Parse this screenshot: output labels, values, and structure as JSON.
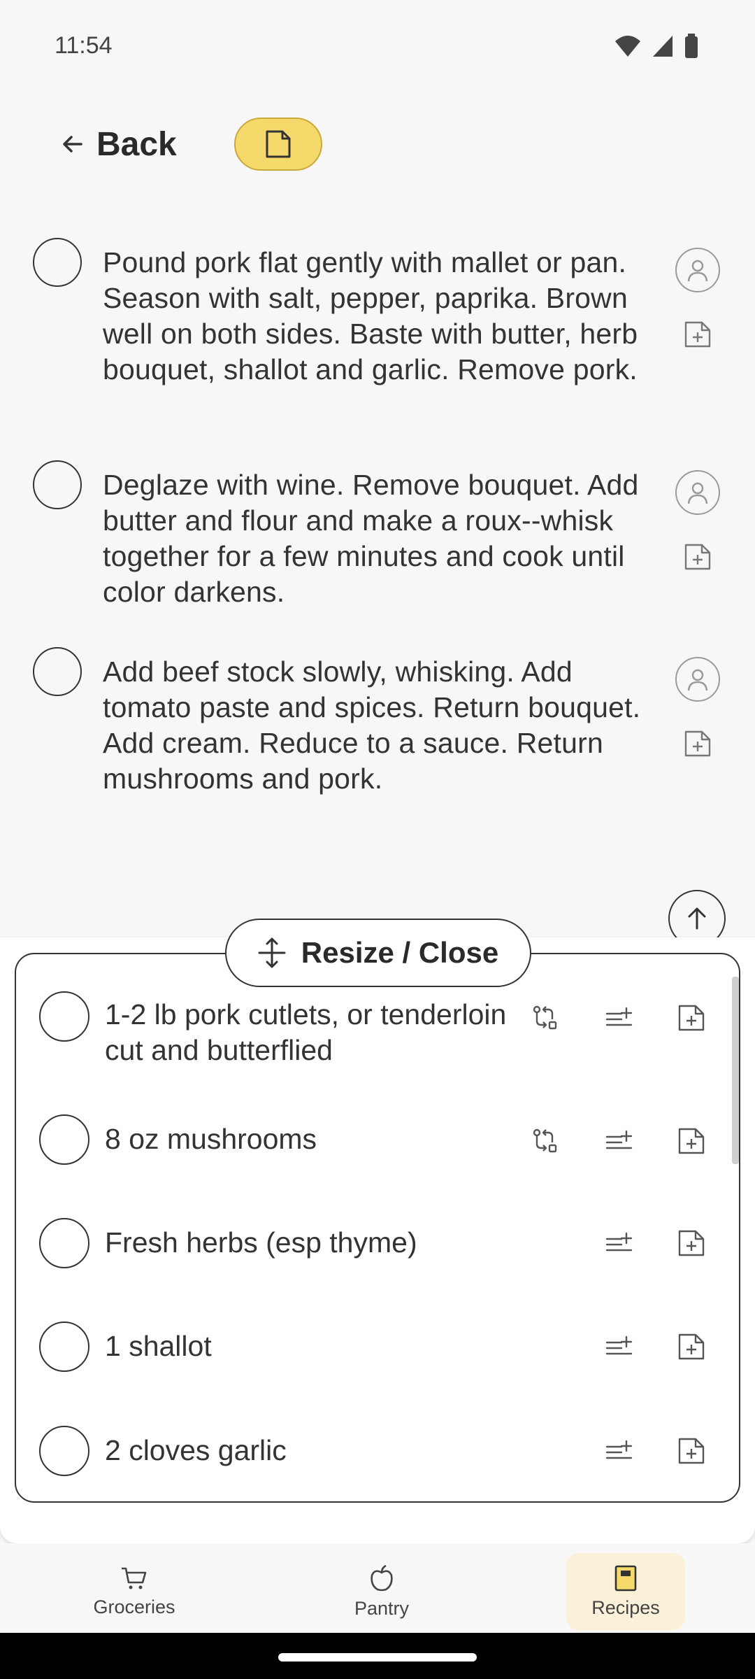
{
  "status_bar": {
    "time": "11:54"
  },
  "header": {
    "back_label": "Back"
  },
  "steps": [
    {
      "text": "Pound pork flat gently with mallet or pan. Season with salt, pepper, paprika. Brown well on both sides. Baste with butter, herb bouquet, shallot and garlic. Remove pork."
    },
    {
      "text": "Deglaze with wine. Remove bouquet. Add butter and flour and make a roux--whisk together for a few minutes and cook until color darkens."
    },
    {
      "text": "Add beef stock slowly, whisking. Add tomato paste and spices. Return bouquet. Add cream. Reduce to a sauce. Return mushrooms and pork."
    }
  ],
  "panel": {
    "resize_label": "Resize / Close",
    "ingredients": [
      {
        "text": "1-2 lb pork cutlets, or tenderloin cut and butterflied",
        "has_substitute": true
      },
      {
        "text": "8 oz mushrooms",
        "has_substitute": true
      },
      {
        "text": "Fresh herbs (esp thyme)",
        "has_substitute": false
      },
      {
        "text": "1 shallot",
        "has_substitute": false
      },
      {
        "text": "2 cloves garlic",
        "has_substitute": false
      }
    ]
  },
  "nav": {
    "items": [
      {
        "label": "Groceries",
        "icon": "cart-icon"
      },
      {
        "label": "Pantry",
        "icon": "apple-icon"
      },
      {
        "label": "Recipes",
        "icon": "book-icon",
        "active": true
      }
    ]
  },
  "colors": {
    "accent": "#f5d96b",
    "active_nav": "#fbf1d8"
  }
}
